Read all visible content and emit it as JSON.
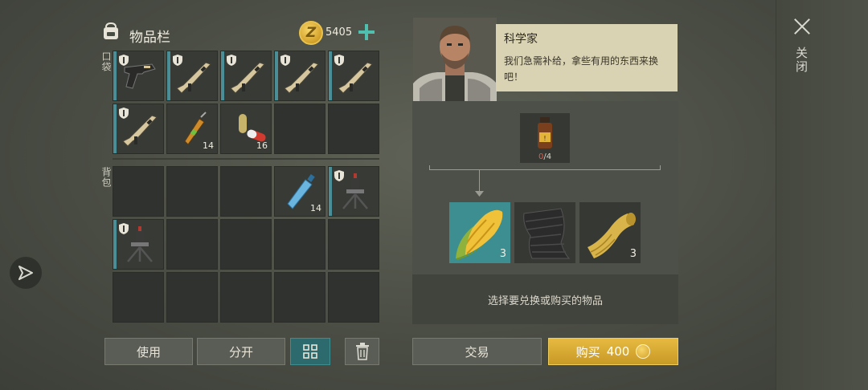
{
  "inventory": {
    "title": "物品栏",
    "coins": "5405",
    "pocket_label": "口袋",
    "backpack_label": "背包",
    "pocket_slots": [
      {
        "item": "pistol",
        "shield": true,
        "count": ""
      },
      {
        "item": "rifle",
        "shield": true,
        "count": ""
      },
      {
        "item": "rifle",
        "shield": true,
        "count": ""
      },
      {
        "item": "rifle",
        "shield": true,
        "count": ""
      },
      {
        "item": "rifle",
        "shield": true,
        "count": ""
      },
      {
        "item": "rifle",
        "shield": true,
        "count": ""
      },
      {
        "item": "stim-vial",
        "shield": false,
        "count": "14"
      },
      {
        "item": "capsules",
        "shield": false,
        "count": "16"
      },
      {
        "item": "",
        "shield": false,
        "count": ""
      },
      {
        "item": "",
        "shield": false,
        "count": ""
      }
    ],
    "backpack_slots": [
      {
        "item": "",
        "shield": false,
        "count": ""
      },
      {
        "item": "",
        "shield": false,
        "count": ""
      },
      {
        "item": "",
        "shield": false,
        "count": ""
      },
      {
        "item": "water-bottle",
        "shield": false,
        "count": "14"
      },
      {
        "item": "turret",
        "shield": true,
        "count": ""
      },
      {
        "item": "turret",
        "shield": true,
        "count": ""
      },
      {
        "item": "",
        "shield": false,
        "count": ""
      },
      {
        "item": "",
        "shield": false,
        "count": ""
      },
      {
        "item": "",
        "shield": false,
        "count": ""
      },
      {
        "item": "",
        "shield": false,
        "count": ""
      },
      {
        "item": "",
        "shield": false,
        "count": ""
      },
      {
        "item": "",
        "shield": false,
        "count": ""
      },
      {
        "item": "",
        "shield": false,
        "count": ""
      },
      {
        "item": "",
        "shield": false,
        "count": ""
      },
      {
        "item": "",
        "shield": false,
        "count": ""
      }
    ],
    "buttons": {
      "use": "使用",
      "split": "分开"
    }
  },
  "npc": {
    "name": "科学家",
    "dialogue": "我们急需补给，拿些有用的东西来换吧！"
  },
  "trade": {
    "required_item": "medicine-bottle",
    "required_have": "0",
    "required_sep": "/",
    "required_need": "4",
    "rewards": [
      {
        "item": "corn",
        "count": "3",
        "selected": true
      },
      {
        "item": "dark-fabric",
        "count": "",
        "selected": false
      },
      {
        "item": "gold-cloth",
        "count": "3",
        "selected": false
      }
    ],
    "hint": "选择要兑换或购买的物品",
    "trade_button": "交易",
    "buy_label": "购买",
    "buy_price": "400"
  },
  "close_label": "关闭",
  "colors": {
    "accent_teal": "#4fbfb0",
    "selected_slot": "#3c8e90",
    "buy_gold": "#d9a932"
  }
}
